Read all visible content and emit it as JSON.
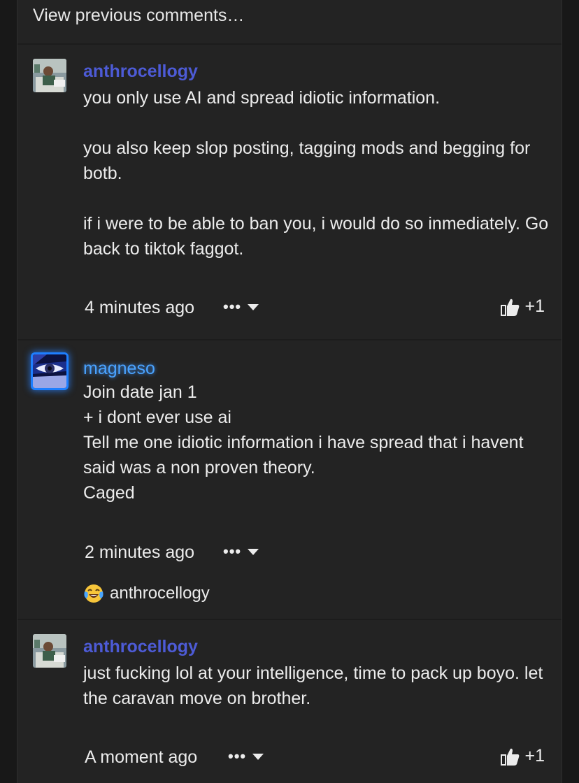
{
  "view_previous": "View previous comments…",
  "comments": [
    {
      "username": "anthrocellogy",
      "paragraphs": [
        "you only use AI and spread idiotic information.",
        "you also keep slop posting, tagging mods and begging for botb.",
        "if i were to be able to ban you, i would do so inmediately. Go back to tiktok faggot."
      ],
      "time": "4 minutes ago",
      "more": "•••",
      "likes": "+1"
    },
    {
      "username": "magneso",
      "lines": [
        "Join date jan 1",
        "+ i dont ever use ai",
        "Tell me one idiotic information i have spread that i havent said was a non proven theory.",
        "Caged"
      ],
      "time": "2 minutes ago",
      "more": "•••",
      "reaction_user": "anthrocellogy"
    },
    {
      "username": "anthrocellogy",
      "paragraphs": [
        "just fucking lol at your intelligence, time to pack up boyo. let the caravan move on brother."
      ],
      "time": "A moment ago",
      "more": "•••",
      "likes": "+1"
    }
  ],
  "icons": {
    "like": "thumbs-up-icon",
    "more": "more-dots-icon",
    "caret": "chevron-down-icon",
    "reaction": "laughing-crying-emoji-icon"
  },
  "colors": {
    "username": "#4d5bd6",
    "username_glow": "#4aa3ff",
    "panel": "#232323",
    "background": "#181818"
  }
}
